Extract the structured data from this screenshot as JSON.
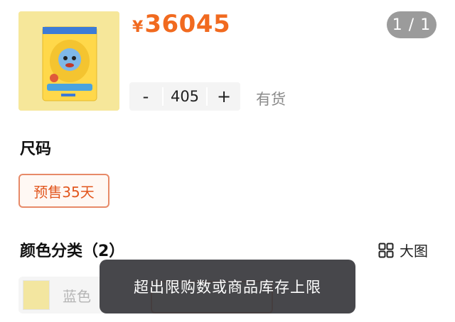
{
  "product": {
    "currency_symbol": "¥",
    "price": "36045",
    "stock_status": "有货"
  },
  "gallery": {
    "counter": "1 / 1"
  },
  "quantity": {
    "decrement_label": "-",
    "value": "405",
    "increment_label": "+"
  },
  "size_section": {
    "title": "尺码",
    "options": [
      {
        "label": "预售35天",
        "selected": true
      }
    ]
  },
  "color_section": {
    "title": "颜色分类（2）",
    "big_view_label": "大图",
    "options": [
      {
        "label": "蓝色"
      }
    ]
  },
  "toast": {
    "message": "超出限购数或商品库存上限"
  },
  "colors": {
    "accent": "#f16a1f",
    "chip_border": "#e78a68",
    "toast_bg": "#37373c"
  },
  "icons": {
    "big_view": "grid-icon"
  }
}
